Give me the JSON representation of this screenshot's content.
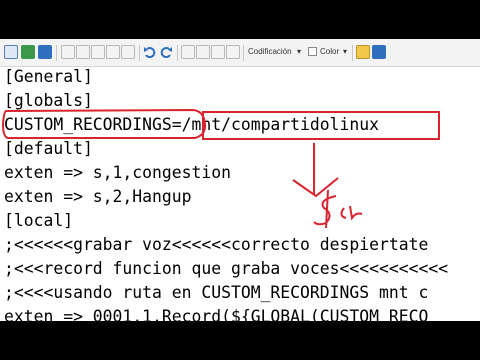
{
  "toolbar": {
    "encoding_label": "Codificación",
    "encoding_arrow": "▾",
    "color_label": "Color",
    "color_arrow": "▾"
  },
  "editor": {
    "lines": [
      "[General]",
      "[globals]",
      "CUSTOM_RECORDINGS=/mnt/compartidolinux",
      "[default]",
      "exten => s,1,congestion",
      "exten => s,2,Hangup",
      "[local]",
      ";<<<<<<grabar voz<<<<<<correcto despiertate",
      ";<<<record funcion que graba voces<<<<<<<<<<<",
      ";<<<<usando ruta en CUSTOM_RECORDINGS mnt c",
      "exten => 0001,1,Record(${GLOBAL(CUSTOM_RECO"
    ]
  },
  "annotations": {
    "ink_color": "#d9232e"
  }
}
